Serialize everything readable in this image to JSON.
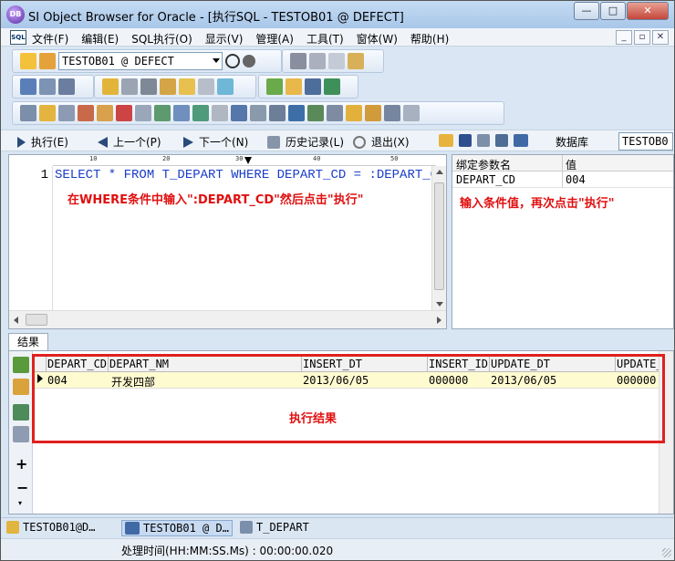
{
  "window": {
    "title": "SI Object Browser for Oracle - [执行SQL  - TESTOB01 @ DEFECT]"
  },
  "app_icon_text": "DB",
  "window_controls": {
    "minimize": "—",
    "maximize": "□",
    "close": "✕"
  },
  "menu": {
    "sql_icon": "SQL",
    "items": [
      "文件(F)",
      "编辑(E)",
      "SQL执行(O)",
      "显示(V)",
      "管理(A)",
      "工具(T)",
      "窗体(W)",
      "帮助(H)"
    ],
    "mdi": {
      "minimize": "_",
      "restore": "▫",
      "close": "✕"
    }
  },
  "toolbar": {
    "connection": "TESTOB01 @ DEFECT"
  },
  "nav": {
    "execute": "执行(E)",
    "prev": "上一个(P)",
    "next": "下一个(N)",
    "history": "历史记录(L)",
    "exit": "退出(X)",
    "database": "数据库",
    "db_value": "TESTOB0"
  },
  "editor": {
    "ruler": [
      "10",
      "20",
      "30",
      "40",
      "50"
    ],
    "line_number": "1",
    "sql": "SELECT * FROM T_DEPART WHERE DEPART_CD = :DEPART_CD",
    "annotation": "在WHERE条件中输入\":DEPART_CD\"然后点击\"执行\""
  },
  "bind": {
    "col_name": "绑定参数名",
    "col_value": "值",
    "param_name": "DEPART_CD",
    "param_value": "004",
    "annotation": "输入条件值，再次点击\"执行\""
  },
  "result": {
    "tab": "结果",
    "columns": [
      "DEPART_CD",
      "DEPART_NM",
      "INSERT_DT",
      "INSERT_ID",
      "UPDATE_DT",
      "UPDATE_"
    ],
    "rows": [
      [
        "004",
        "开发四部",
        "2013/06/05",
        "000000",
        "2013/06/05",
        "000000"
      ]
    ],
    "annotation": "执行结果"
  },
  "taskbar": [
    "TESTOB01@D…",
    "TESTOB01 @ D…",
    "T_DEPART"
  ],
  "status": {
    "text": "处理时间(HH:MM:SS.Ms) : 00:00:00.020"
  },
  "colors": {
    "annotation_red": "#e01010",
    "sql_blue": "#1a3cc9",
    "row_highlight": "#fffbd1"
  }
}
